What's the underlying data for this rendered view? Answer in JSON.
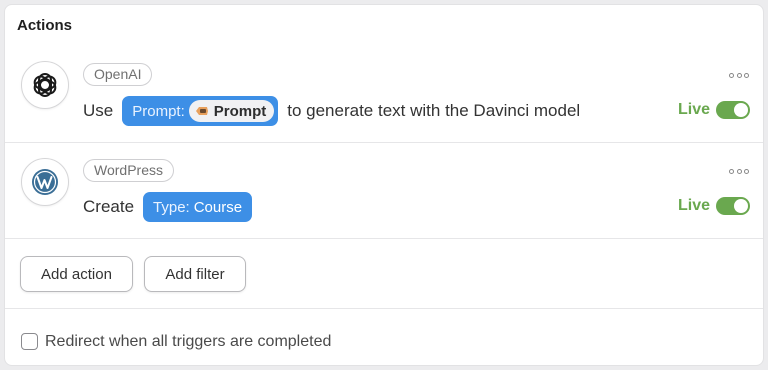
{
  "section_title": "Actions",
  "actions": [
    {
      "app_name": "OpenAI",
      "logo_icon": "openai-logo-icon",
      "verb": "Use",
      "token": {
        "label": "Prompt:",
        "value": "Prompt",
        "value_icon": "zapier-mini-icon"
      },
      "after_text": "to generate text with the Davinci model",
      "status": "Live",
      "enabled": true
    },
    {
      "app_name": "WordPress",
      "logo_icon": "wordpress-logo-icon",
      "verb": "Create",
      "token": {
        "label": "Type:",
        "value": "Course"
      },
      "status": "Live",
      "enabled": true
    }
  ],
  "buttons": {
    "add_action": "Add action",
    "add_filter": "Add filter"
  },
  "redirect": {
    "label": "Redirect when all triggers are completed",
    "checked": false
  },
  "colors": {
    "token_bg": "#3d8fe6",
    "live_green": "#6aa84f",
    "wordpress_blue": "#3a6e96"
  }
}
